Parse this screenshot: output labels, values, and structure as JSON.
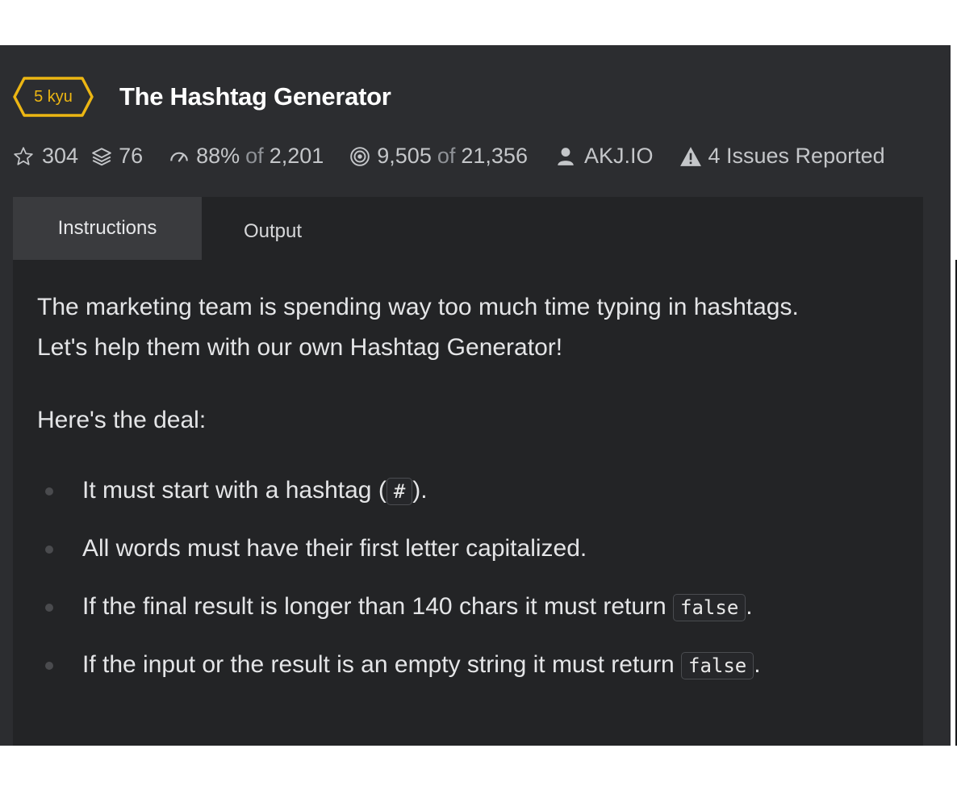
{
  "kata": {
    "rank": "5 kyu",
    "title": "The Hashtag Generator"
  },
  "stats": {
    "stars": "304",
    "collections": "76",
    "satisfaction": "88%",
    "satisfaction_of": "of",
    "votes": "2,201",
    "completed": "9,505",
    "completed_of": "of",
    "attempts": "21,356",
    "author": "AKJ.IO",
    "issues": "4 Issues Reported"
  },
  "tabs": [
    {
      "label": "Instructions",
      "active": true
    },
    {
      "label": "Output",
      "active": false
    }
  ],
  "description": {
    "intro_line1": "The marketing team is spending way too much time typing in hashtags.",
    "intro_line2": "Let's help them with our own Hashtag Generator!",
    "deal": "Here's the deal:",
    "rules": [
      {
        "before": "It must start with a hashtag (",
        "code": "#",
        "after": ")."
      },
      {
        "text": "All words must have their first letter capitalized."
      },
      {
        "before": "If the final result is longer than 140 chars it must return ",
        "code": "false",
        "after": "."
      },
      {
        "before": "If the input or the result is an empty string it must return ",
        "code": "false",
        "after": "."
      }
    ]
  },
  "icons": {
    "star": "star-outline-icon",
    "collections": "layers-icon",
    "satisfaction": "gauge-icon",
    "completed": "target-icon",
    "author": "user-icon",
    "issues": "warning-icon"
  },
  "colors": {
    "rank_accent": "#ecb613",
    "panel_bg": "#2c2d30",
    "tabs_bg": "#232426",
    "active_tab_bg": "#3a3b3e"
  }
}
